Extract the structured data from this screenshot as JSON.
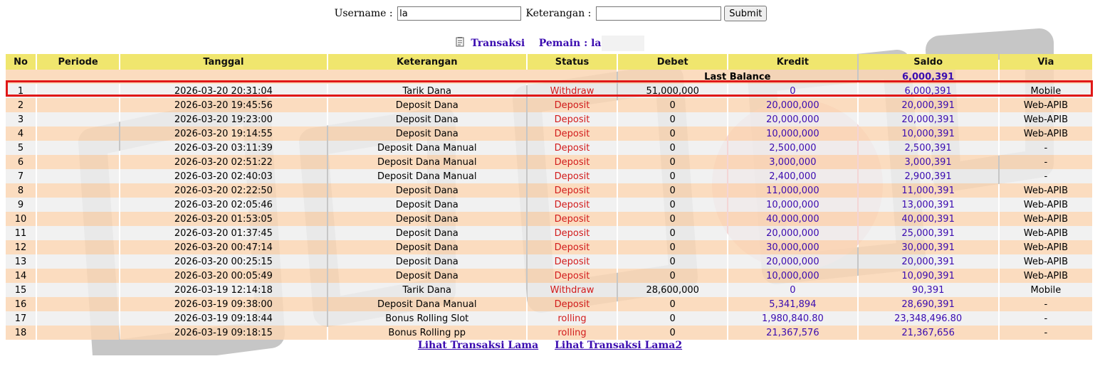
{
  "search": {
    "username_label": "Username :",
    "username_value": "la",
    "keterangan_label": "Keterangan :",
    "keterangan_value": "",
    "submit_label": "Submit"
  },
  "heading": {
    "title": "Transaksi",
    "player_label": "Pemain : la"
  },
  "table": {
    "headers": [
      "No",
      "Periode",
      "Tanggal",
      "Keterangan",
      "Status",
      "Debet",
      "Kredit",
      "Saldo",
      "Via"
    ],
    "last_balance_label": "Last Balance",
    "last_balance_value": "6,000,391",
    "rows": [
      {
        "no": "1",
        "periode": "",
        "tanggal": "2026-03-20 20:31:04",
        "ket": "Tarik Dana",
        "status": "Withdraw",
        "debet": "51,000,000",
        "kredit": "0",
        "saldo": "6,000,391",
        "via": "Mobile"
      },
      {
        "no": "2",
        "periode": "",
        "tanggal": "2026-03-20 19:45:56",
        "ket": "Deposit Dana",
        "status": "Deposit",
        "debet": "0",
        "kredit": "20,000,000",
        "saldo": "20,000,391",
        "via": "Web-APIB"
      },
      {
        "no": "3",
        "periode": "",
        "tanggal": "2026-03-20 19:23:00",
        "ket": "Deposit Dana",
        "status": "Deposit",
        "debet": "0",
        "kredit": "20,000,000",
        "saldo": "20,000,391",
        "via": "Web-APIB"
      },
      {
        "no": "4",
        "periode": "",
        "tanggal": "2026-03-20 19:14:55",
        "ket": "Deposit Dana",
        "status": "Deposit",
        "debet": "0",
        "kredit": "10,000,000",
        "saldo": "10,000,391",
        "via": "Web-APIB"
      },
      {
        "no": "5",
        "periode": "",
        "tanggal": "2026-03-20 03:11:39",
        "ket": "Deposit Dana Manual",
        "status": "Deposit",
        "debet": "0",
        "kredit": "2,500,000",
        "saldo": "2,500,391",
        "via": "-"
      },
      {
        "no": "6",
        "periode": "",
        "tanggal": "2026-03-20 02:51:22",
        "ket": "Deposit Dana Manual",
        "status": "Deposit",
        "debet": "0",
        "kredit": "3,000,000",
        "saldo": "3,000,391",
        "via": "-"
      },
      {
        "no": "7",
        "periode": "",
        "tanggal": "2026-03-20 02:40:03",
        "ket": "Deposit Dana Manual",
        "status": "Deposit",
        "debet": "0",
        "kredit": "2,400,000",
        "saldo": "2,900,391",
        "via": "-"
      },
      {
        "no": "8",
        "periode": "",
        "tanggal": "2026-03-20 02:22:50",
        "ket": "Deposit Dana",
        "status": "Deposit",
        "debet": "0",
        "kredit": "11,000,000",
        "saldo": "11,000,391",
        "via": "Web-APIB"
      },
      {
        "no": "9",
        "periode": "",
        "tanggal": "2026-03-20 02:05:46",
        "ket": "Deposit Dana",
        "status": "Deposit",
        "debet": "0",
        "kredit": "10,000,000",
        "saldo": "13,000,391",
        "via": "Web-APIB"
      },
      {
        "no": "10",
        "periode": "",
        "tanggal": "2026-03-20 01:53:05",
        "ket": "Deposit Dana",
        "status": "Deposit",
        "debet": "0",
        "kredit": "40,000,000",
        "saldo": "40,000,391",
        "via": "Web-APIB"
      },
      {
        "no": "11",
        "periode": "",
        "tanggal": "2026-03-20 01:37:45",
        "ket": "Deposit Dana",
        "status": "Deposit",
        "debet": "0",
        "kredit": "20,000,000",
        "saldo": "25,000,391",
        "via": "Web-APIB"
      },
      {
        "no": "12",
        "periode": "",
        "tanggal": "2026-03-20 00:47:14",
        "ket": "Deposit Dana",
        "status": "Deposit",
        "debet": "0",
        "kredit": "30,000,000",
        "saldo": "30,000,391",
        "via": "Web-APIB"
      },
      {
        "no": "13",
        "periode": "",
        "tanggal": "2026-03-20 00:25:15",
        "ket": "Deposit Dana",
        "status": "Deposit",
        "debet": "0",
        "kredit": "20,000,000",
        "saldo": "20,000,391",
        "via": "Web-APIB"
      },
      {
        "no": "14",
        "periode": "",
        "tanggal": "2026-03-20 00:05:49",
        "ket": "Deposit Dana",
        "status": "Deposit",
        "debet": "0",
        "kredit": "10,000,000",
        "saldo": "10,090,391",
        "via": "Web-APIB"
      },
      {
        "no": "15",
        "periode": "",
        "tanggal": "2026-03-19 12:14:18",
        "ket": "Tarik Dana",
        "status": "Withdraw",
        "debet": "28,600,000",
        "kredit": "0",
        "saldo": "90,391",
        "via": "Mobile"
      },
      {
        "no": "16",
        "periode": "",
        "tanggal": "2026-03-19 09:38:00",
        "ket": "Deposit Dana Manual",
        "status": "Deposit",
        "debet": "0",
        "kredit": "5,341,894",
        "saldo": "28,690,391",
        "via": "-"
      },
      {
        "no": "17",
        "periode": "",
        "tanggal": "2026-03-19 09:18:44",
        "ket": "Bonus Rolling Slot",
        "status": "rolling",
        "debet": "0",
        "kredit": "1,980,840.80",
        "saldo": "23,348,496.80",
        "via": "-"
      },
      {
        "no": "18",
        "periode": "",
        "tanggal": "2026-03-19 09:18:15",
        "ket": "Bonus Rolling pp",
        "status": "rolling",
        "debet": "0",
        "kredit": "21,367,576",
        "saldo": "21,367,656",
        "via": "-"
      }
    ]
  },
  "footer": {
    "link1": "Lihat Transaksi Lama",
    "link2": "Lihat Transaksi Lama2"
  },
  "colors": {
    "header_bg": "#f0e66e",
    "row_even": "#fad6b4",
    "row_odd": "#eeeeee",
    "status": "#d21b1b",
    "amount": "#3a0bb0",
    "highlight_border": "#e01818"
  },
  "icons": {
    "heading_icon": "document-icon",
    "watermark": "logo-watermark"
  }
}
